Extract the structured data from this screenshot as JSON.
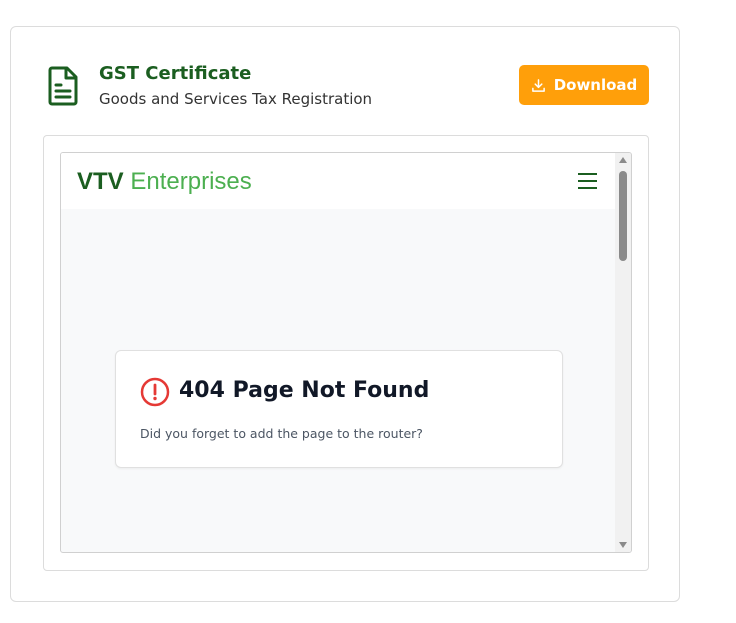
{
  "header": {
    "title": "GST Certificate",
    "subtitle": "Goods and Services Tax Registration",
    "download_label": "Download"
  },
  "preview": {
    "brand_strong": "VTV",
    "brand_light": "Enterprises",
    "error_title": "404 Page Not Found",
    "error_message": "Did you forget to add the page to the router?"
  },
  "icons": {
    "document": "document-icon",
    "download": "download-icon",
    "menu": "hamburger-menu-icon",
    "error": "alert-circle-icon"
  },
  "colors": {
    "title_green": "#1b5e20",
    "brand_light_green": "#4caf50",
    "download_orange": "#ff9f0a",
    "error_red": "#e53935"
  }
}
